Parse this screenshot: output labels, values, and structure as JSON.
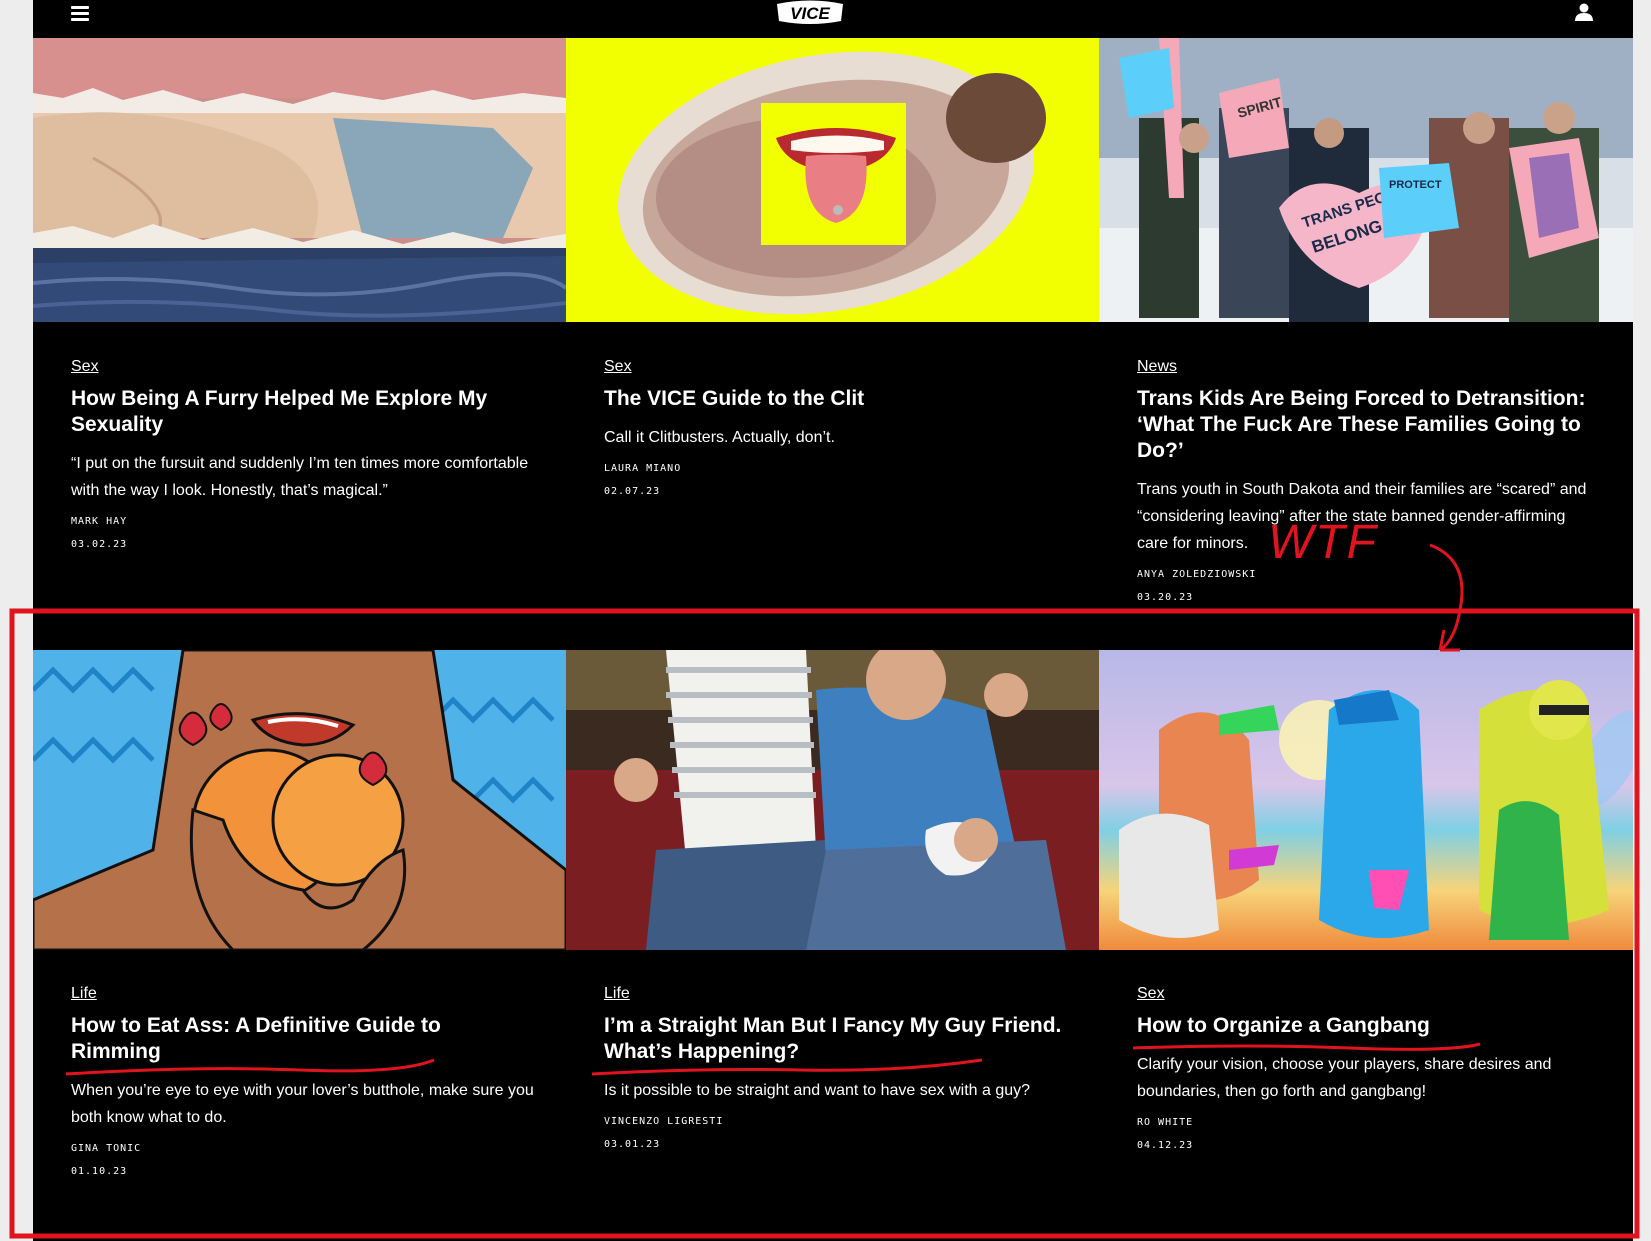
{
  "header": {
    "logo_text": "VICE",
    "menu_icon": "hamburger-menu-icon",
    "user_icon": "user-account-icon"
  },
  "articles": [
    {
      "category": "Sex",
      "title": "How Being A Furry Helped Me Explore My Sexuality",
      "dek": "“I put on the fursuit and suddenly I’m ten times more comfortable with the way I look. Honestly, that’s magical.”",
      "author": "MARK HAY",
      "date": "03.02.23"
    },
    {
      "category": "Sex",
      "title": "The VICE Guide to the Clit",
      "dek": "Call it Clitbusters. Actually, don’t.",
      "author": "LAURA MIANO",
      "date": "02.07.23"
    },
    {
      "category": "News",
      "title": "Trans Kids Are Being Forced to Detransition: ‘What The Fuck Are These Families Going to Do?’",
      "dek": "Trans youth in South Dakota and their families are “scared” and “considering leaving” after the state banned gender-affirming care for minors.",
      "author": "ANYA ZOLEDZIOWSKI",
      "date": "03.20.23",
      "image_sign_text": [
        "SPIRIT",
        "TRANS PEOPLE",
        "BELONG",
        "PROTECT"
      ]
    },
    {
      "category": "Life",
      "title": "How to Eat Ass: A Definitive Guide to Rimming",
      "dek": "When you’re eye to eye with your lover’s butthole, make sure you both know what to do.",
      "author": "GINA TONIC",
      "date": "01.10.23"
    },
    {
      "category": "Life",
      "title": "I’m a Straight Man But I Fancy My Guy Friend. What’s Happening?",
      "dek": "Is it possible to be straight and want to have sex with a guy?",
      "author": "VINCENZO LIGRESTI",
      "date": "03.01.23"
    },
    {
      "category": "Sex",
      "title": "How to Organize a Gangbang",
      "dek": "Clarify your vision, choose your players, share desires and boundaries, then go forth and gangbang!",
      "author": "RO WHITE",
      "date": "04.12.23"
    }
  ],
  "annotation": {
    "handwritten_text": "WTF",
    "color": "#e0141e"
  }
}
